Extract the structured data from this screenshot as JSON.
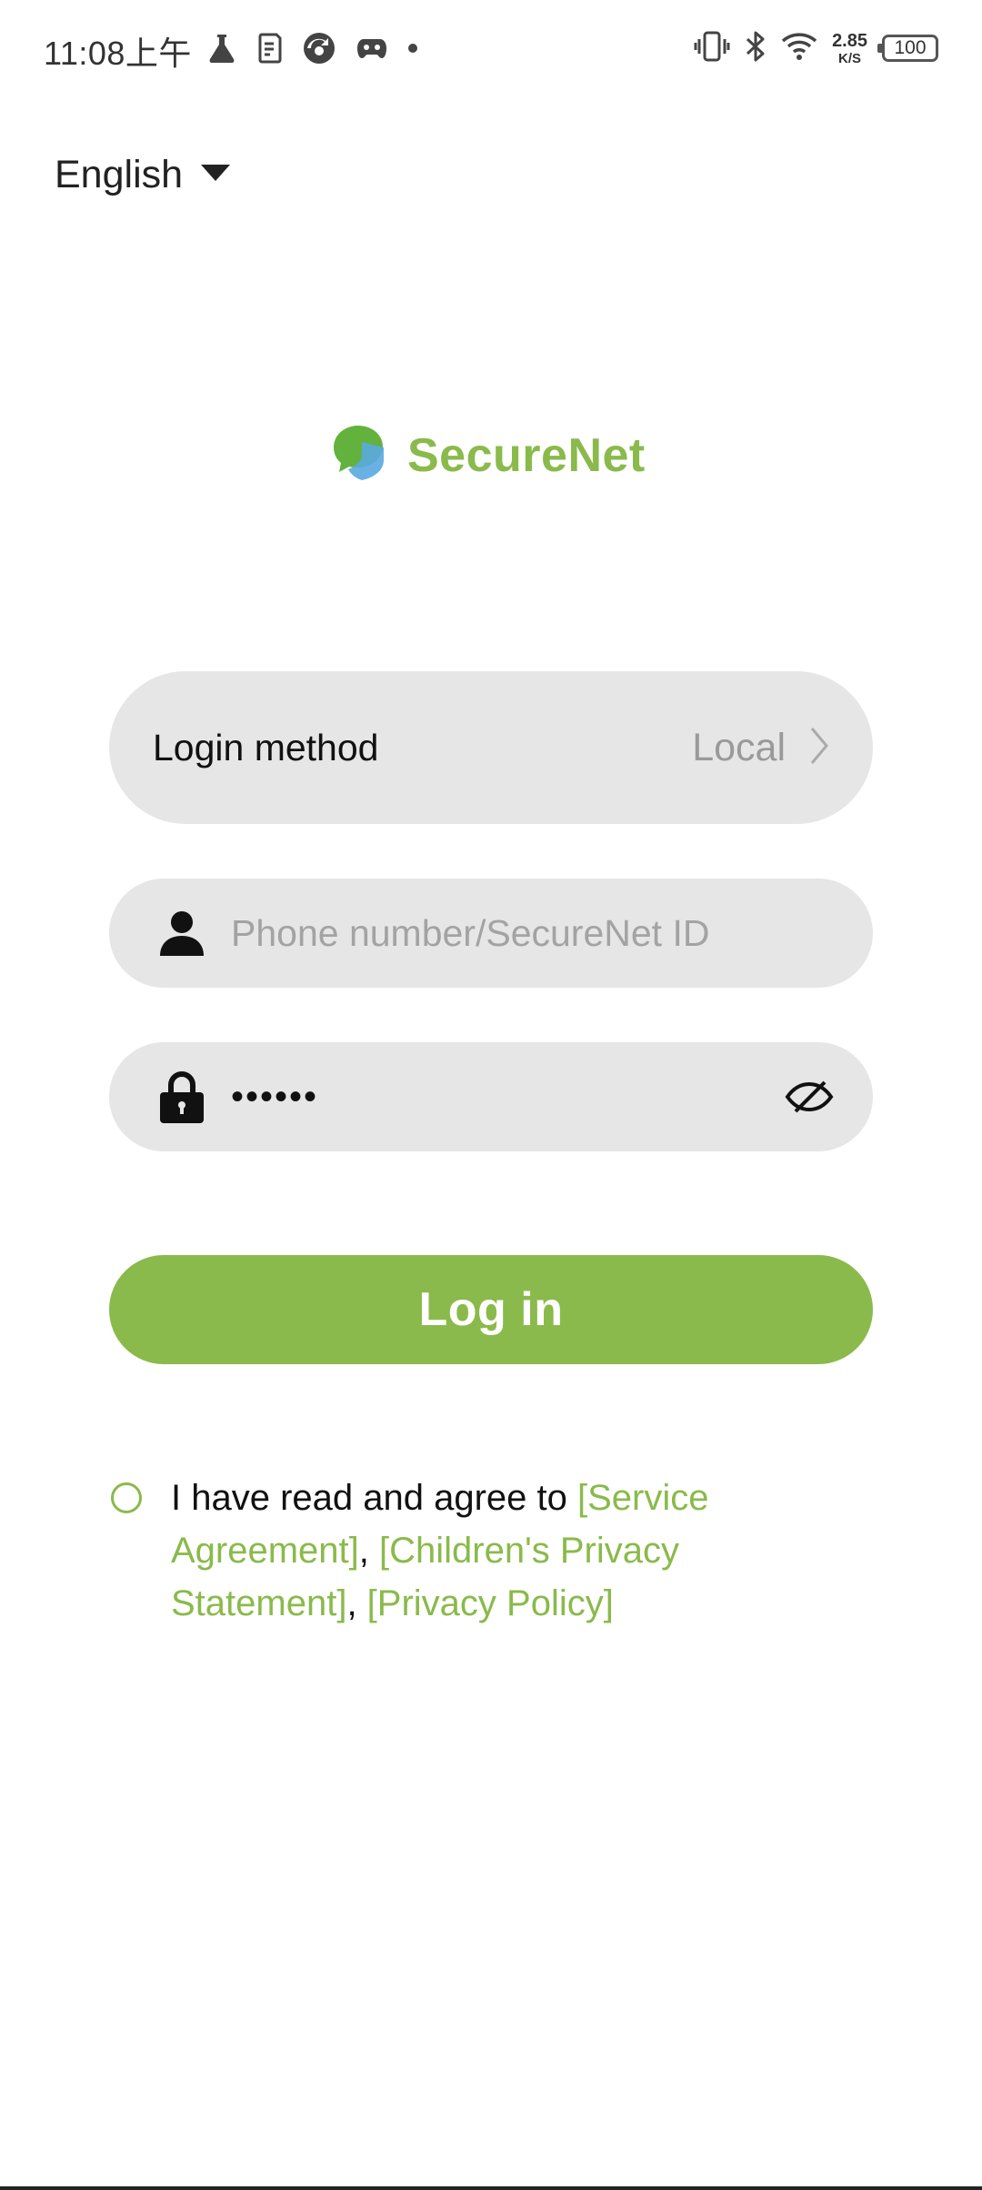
{
  "status_bar": {
    "time": "11:08上午",
    "left_icons": [
      "flask-icon",
      "sim-icon",
      "app-circle-icon",
      "gamepad-icon",
      "dot-icon"
    ],
    "right_icons": [
      "vibrate-icon",
      "bluetooth-icon",
      "wifi-icon"
    ],
    "net_speed_value": "2.85",
    "net_speed_unit": "K/S",
    "battery": "100"
  },
  "language_selector": {
    "label": "English",
    "icon": "caret-down-icon"
  },
  "logo": {
    "text": "SecureNet",
    "icon": "chat-shield-logo-icon",
    "brand_color": "#8aba4b",
    "logo_secondary_color": "#5aa9e0"
  },
  "form": {
    "login_method": {
      "label": "Login method",
      "value": "Local",
      "icon": "chevron-right-icon"
    },
    "account": {
      "placeholder": "Phone number/SecureNet ID",
      "value": "",
      "icon": "user-icon"
    },
    "password": {
      "value": "••••••",
      "icon": "lock-icon",
      "toggle_icon": "eye-off-icon"
    },
    "login_button": "Log in",
    "accent_color": "#8aba4b"
  },
  "agreement": {
    "prefix": "I have read and agree to ",
    "links": [
      "[Service Agreement]",
      "[Children's Privacy Statement]",
      "[Privacy Policy]"
    ],
    "separator": ", "
  }
}
